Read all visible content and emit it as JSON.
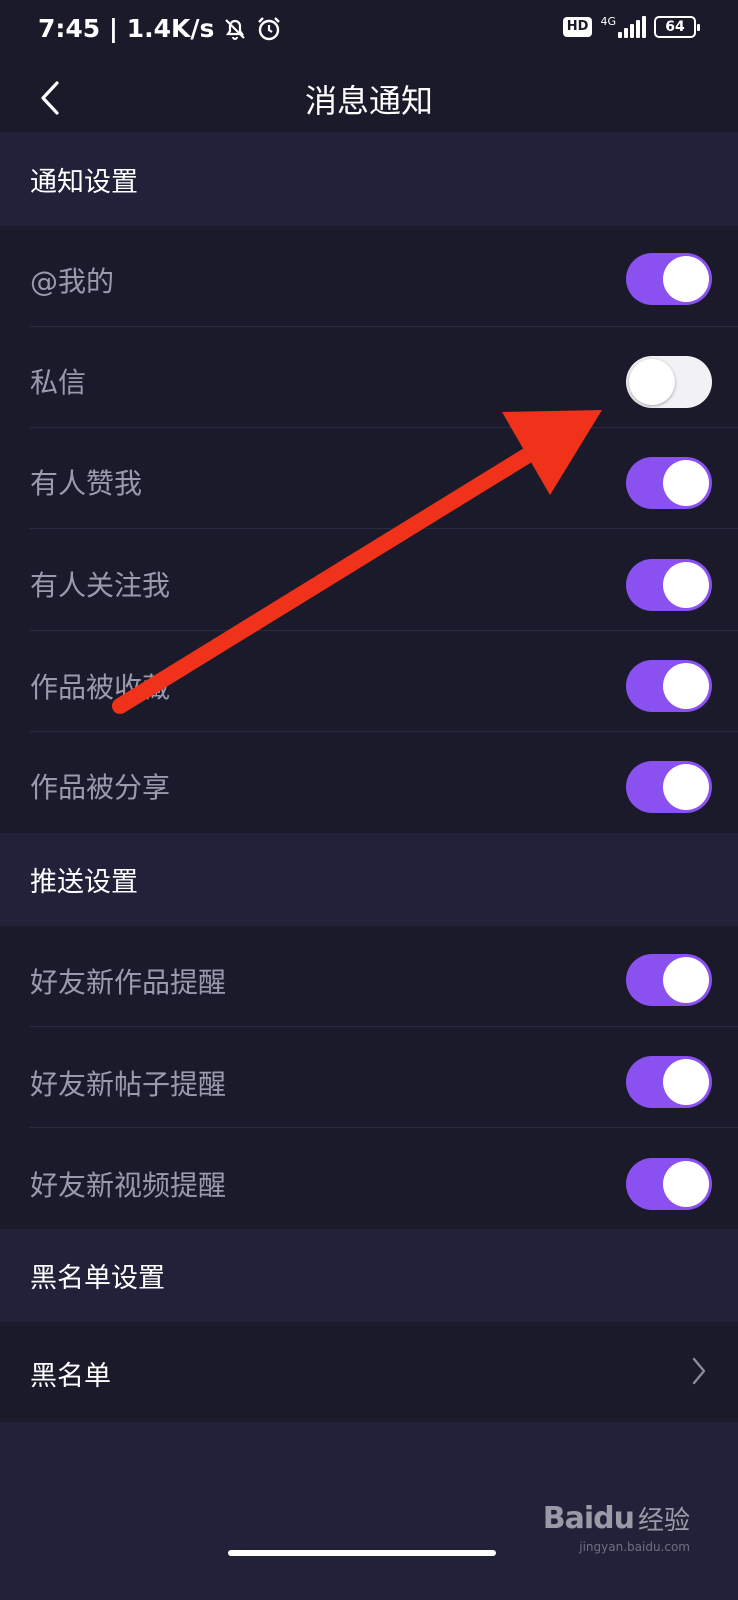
{
  "status_bar": {
    "time_speed": "7:45 | 1.4K/s",
    "hd_badge": "HD",
    "network": "4G",
    "battery": "64"
  },
  "header": {
    "title": "消息通知"
  },
  "sections": [
    {
      "title": "通知设置",
      "items": [
        {
          "label": "@我的",
          "enabled": true
        },
        {
          "label": "私信",
          "enabled": false
        },
        {
          "label": "有人赞我",
          "enabled": true
        },
        {
          "label": "有人关注我",
          "enabled": true
        },
        {
          "label": "作品被收藏",
          "enabled": true
        },
        {
          "label": "作品被分享",
          "enabled": true
        }
      ]
    },
    {
      "title": "推送设置",
      "items": [
        {
          "label": "好友新作品提醒",
          "enabled": true
        },
        {
          "label": "好友新帖子提醒",
          "enabled": true
        },
        {
          "label": "好友新视频提醒",
          "enabled": true
        }
      ]
    },
    {
      "title": "黑名单设置",
      "items": [
        {
          "label": "黑名单"
        }
      ]
    }
  ],
  "watermark": {
    "logo": "Baidu",
    "text": "经验",
    "sub": "jingyan.baidu.com"
  },
  "colors": {
    "background": "#1a1a2b",
    "section_header": "#21213a",
    "toggle_on": "#8a50f0",
    "toggle_off": "#f2f2f5",
    "annotation_arrow": "#f0321a"
  },
  "icons": [
    "back-chevron-icon",
    "chevron-right-icon",
    "mute-bell-icon",
    "alarm-clock-icon",
    "signal-icon",
    "battery-icon"
  ]
}
